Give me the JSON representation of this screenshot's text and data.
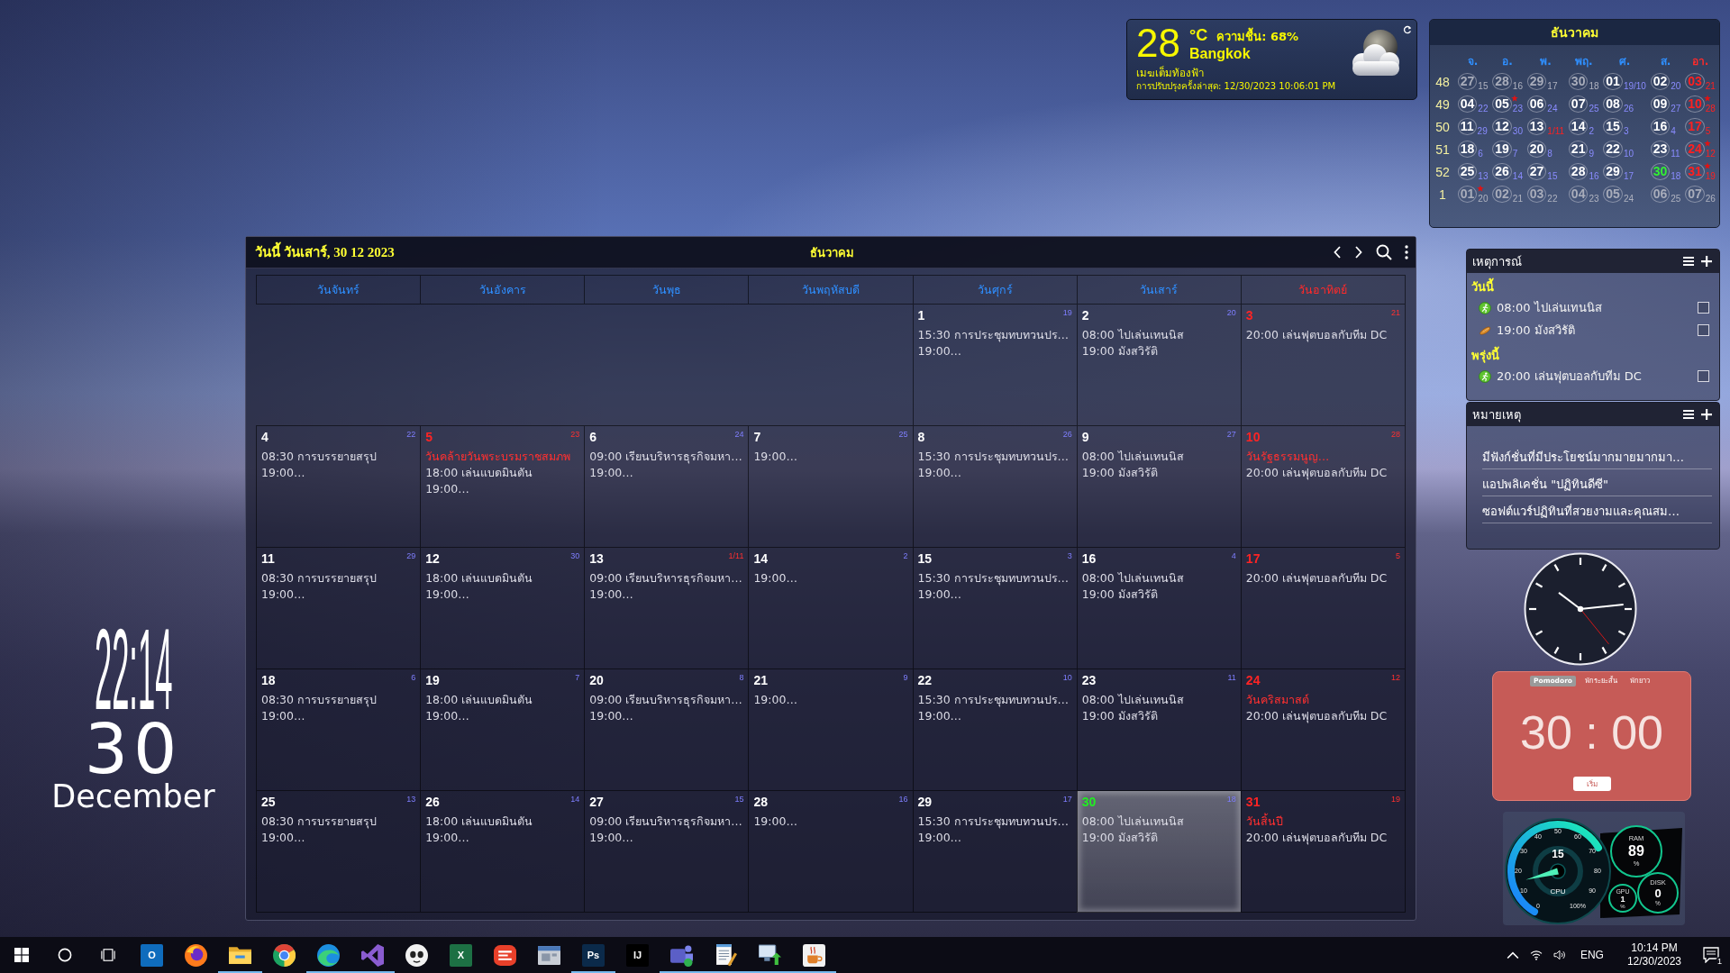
{
  "desktop_clock": {
    "time": "22:14",
    "day": "30",
    "month": "December"
  },
  "weather": {
    "temperature": "28",
    "unit": "°C",
    "humidity": "ความชื้น: 68%",
    "city": "Bangkok",
    "condition": "เมฆเต็มท้องฟ้า",
    "updated": "การปรับปรุงครั้งล่าสุด: 12/30/2023 10:06:01 PM"
  },
  "mini_calendar": {
    "title": "ธันวาคม",
    "weekdays": [
      {
        "label": "จ.",
        "kind": "weekday"
      },
      {
        "label": "อ.",
        "kind": "weekday"
      },
      {
        "label": "พ.",
        "kind": "weekday"
      },
      {
        "label": "พฤ.",
        "kind": "weekday"
      },
      {
        "label": "ศ.",
        "kind": "weekday"
      },
      {
        "label": "ส.",
        "kind": "weekday"
      },
      {
        "label": "อา.",
        "kind": "sunday"
      }
    ],
    "weeks": [
      {
        "number": "48",
        "days": [
          {
            "day": "27",
            "lunar": "15",
            "kind": "other",
            "star": false,
            "lunar_red": false
          },
          {
            "day": "28",
            "lunar": "16",
            "kind": "other",
            "star": false,
            "lunar_red": false
          },
          {
            "day": "29",
            "lunar": "17",
            "kind": "other",
            "star": false,
            "lunar_red": false
          },
          {
            "day": "30",
            "lunar": "18",
            "kind": "other",
            "star": false,
            "lunar_red": false
          },
          {
            "day": "01",
            "lunar": "19/10",
            "kind": "weekday",
            "star": false,
            "lunar_red": false
          },
          {
            "day": "02",
            "lunar": "20",
            "kind": "weekday",
            "star": false,
            "lunar_red": false
          },
          {
            "day": "03",
            "lunar": "21",
            "kind": "sunday",
            "star": false,
            "lunar_red": true
          }
        ]
      },
      {
        "number": "49",
        "days": [
          {
            "day": "04",
            "lunar": "22",
            "kind": "weekday",
            "star": false,
            "lunar_red": false
          },
          {
            "day": "05",
            "lunar": "23",
            "kind": "weekday",
            "star": true,
            "lunar_red": false
          },
          {
            "day": "06",
            "lunar": "24",
            "kind": "weekday",
            "star": false,
            "lunar_red": false
          },
          {
            "day": "07",
            "lunar": "25",
            "kind": "weekday",
            "star": false,
            "lunar_red": false
          },
          {
            "day": "08",
            "lunar": "26",
            "kind": "weekday",
            "star": false,
            "lunar_red": false
          },
          {
            "day": "09",
            "lunar": "27",
            "kind": "weekday",
            "star": false,
            "lunar_red": false
          },
          {
            "day": "10",
            "lunar": "28",
            "kind": "sunday",
            "star": true,
            "lunar_red": true
          }
        ]
      },
      {
        "number": "50",
        "days": [
          {
            "day": "11",
            "lunar": "29",
            "kind": "weekday",
            "star": false,
            "lunar_red": false
          },
          {
            "day": "12",
            "lunar": "30",
            "kind": "weekday",
            "star": false,
            "lunar_red": false
          },
          {
            "day": "13",
            "lunar": "1/11",
            "kind": "weekday",
            "star": false,
            "lunar_red": true
          },
          {
            "day": "14",
            "lunar": "2",
            "kind": "weekday",
            "star": false,
            "lunar_red": false
          },
          {
            "day": "15",
            "lunar": "3",
            "kind": "weekday",
            "star": false,
            "lunar_red": false
          },
          {
            "day": "16",
            "lunar": "4",
            "kind": "weekday",
            "star": false,
            "lunar_red": false
          },
          {
            "day": "17",
            "lunar": "5",
            "kind": "sunday",
            "star": false,
            "lunar_red": true
          }
        ]
      },
      {
        "number": "51",
        "days": [
          {
            "day": "18",
            "lunar": "6",
            "kind": "weekday",
            "star": false,
            "lunar_red": false
          },
          {
            "day": "19",
            "lunar": "7",
            "kind": "weekday",
            "star": false,
            "lunar_red": false
          },
          {
            "day": "20",
            "lunar": "8",
            "kind": "weekday",
            "star": false,
            "lunar_red": false
          },
          {
            "day": "21",
            "lunar": "9",
            "kind": "weekday",
            "star": false,
            "lunar_red": false
          },
          {
            "day": "22",
            "lunar": "10",
            "kind": "weekday",
            "star": false,
            "lunar_red": false
          },
          {
            "day": "23",
            "lunar": "11",
            "kind": "weekday",
            "star": false,
            "lunar_red": false
          },
          {
            "day": "24",
            "lunar": "12",
            "kind": "sunday",
            "star": true,
            "lunar_red": true
          }
        ]
      },
      {
        "number": "52",
        "days": [
          {
            "day": "25",
            "lunar": "13",
            "kind": "weekday",
            "star": false,
            "lunar_red": false
          },
          {
            "day": "26",
            "lunar": "14",
            "kind": "weekday",
            "star": false,
            "lunar_red": false
          },
          {
            "day": "27",
            "lunar": "15",
            "kind": "weekday",
            "star": false,
            "lunar_red": false
          },
          {
            "day": "28",
            "lunar": "16",
            "kind": "weekday",
            "star": false,
            "lunar_red": false
          },
          {
            "day": "29",
            "lunar": "17",
            "kind": "weekday",
            "star": false,
            "lunar_red": false
          },
          {
            "day": "30",
            "lunar": "18",
            "kind": "today",
            "star": false,
            "lunar_red": false
          },
          {
            "day": "31",
            "lunar": "19",
            "kind": "sunday",
            "star": true,
            "lunar_red": true
          }
        ]
      },
      {
        "number": "1",
        "days": [
          {
            "day": "01",
            "lunar": "20",
            "kind": "other",
            "star": true,
            "lunar_red": false
          },
          {
            "day": "02",
            "lunar": "21",
            "kind": "other",
            "star": false,
            "lunar_red": false
          },
          {
            "day": "03",
            "lunar": "22",
            "kind": "other",
            "star": false,
            "lunar_red": false
          },
          {
            "day": "04",
            "lunar": "23",
            "kind": "other",
            "star": false,
            "lunar_red": false
          },
          {
            "day": "05",
            "lunar": "24",
            "kind": "other",
            "star": false,
            "lunar_red": false
          },
          {
            "day": "06",
            "lunar": "25",
            "kind": "other",
            "star": false,
            "lunar_red": false
          },
          {
            "day": "07",
            "lunar": "26",
            "kind": "other",
            "star": false,
            "lunar_red": false
          }
        ]
      }
    ]
  },
  "calendar": {
    "today_label": "วันนี้ วันเสาร์, 30 12 2023",
    "month": "ธันวาคม",
    "weekdays": [
      {
        "label": "วันจันทร์",
        "kind": "weekday"
      },
      {
        "label": "วันอังคาร",
        "kind": "weekday"
      },
      {
        "label": "วันพุธ",
        "kind": "weekday"
      },
      {
        "label": "วันพฤหัสบดี",
        "kind": "weekday"
      },
      {
        "label": "วันศุกร์",
        "kind": "weekday"
      },
      {
        "label": "วันเสาร์",
        "kind": "weekday"
      },
      {
        "label": "วันอาทิตย์",
        "kind": "sunday"
      }
    ],
    "weeks": [
      {
        "cells": [
          {
            "kind": "blank"
          },
          {
            "kind": "blank"
          },
          {
            "kind": "blank"
          },
          {
            "kind": "blank"
          },
          {
            "day": "1",
            "lunar": "19",
            "kind": "weekday",
            "lunar_red": false,
            "events": [
              {
                "text": "15:30 การประชุมทบทวนปร…",
                "kind": "event"
              },
              {
                "text": "19:00…",
                "kind": "event"
              }
            ]
          },
          {
            "day": "2",
            "lunar": "20",
            "kind": "weekday",
            "lunar_red": false,
            "events": [
              {
                "text": "08:00 ไปเล่นเทนนิส",
                "kind": "event"
              },
              {
                "text": "19:00 มังสวิรัติ",
                "kind": "event"
              }
            ]
          },
          {
            "day": "3",
            "lunar": "21",
            "kind": "sunday",
            "lunar_red": true,
            "events": [
              {
                "text": "20:00 เล่นฟุตบอลกับทีม DC",
                "kind": "event"
              }
            ]
          }
        ]
      },
      {
        "cells": [
          {
            "day": "4",
            "lunar": "22",
            "kind": "weekday",
            "lunar_red": false,
            "events": [
              {
                "text": "08:30 การบรรยายสรุป",
                "kind": "event"
              },
              {
                "text": "19:00…",
                "kind": "event"
              }
            ]
          },
          {
            "day": "5",
            "lunar": "23",
            "kind": "holiday",
            "lunar_red": true,
            "events": [
              {
                "text": "วันคล้ายวันพระบรมราชสมภพ",
                "kind": "holiday"
              },
              {
                "text": "18:00 เล่นแบดมินตัน",
                "kind": "event"
              },
              {
                "text": "19:00…",
                "kind": "event"
              }
            ]
          },
          {
            "day": "6",
            "lunar": "24",
            "kind": "weekday",
            "lunar_red": false,
            "events": [
              {
                "text": "09:00 เรียนบริหารธุรกิจมหา…",
                "kind": "event"
              },
              {
                "text": "19:00…",
                "kind": "event"
              }
            ]
          },
          {
            "day": "7",
            "lunar": "25",
            "kind": "weekday",
            "lunar_red": false,
            "events": [
              {
                "text": "19:00…",
                "kind": "event"
              }
            ]
          },
          {
            "day": "8",
            "lunar": "26",
            "kind": "weekday",
            "lunar_red": false,
            "events": [
              {
                "text": "15:30 การประชุมทบทวนปร…",
                "kind": "event"
              },
              {
                "text": "19:00…",
                "kind": "event"
              }
            ]
          },
          {
            "day": "9",
            "lunar": "27",
            "kind": "weekday",
            "lunar_red": false,
            "events": [
              {
                "text": "08:00 ไปเล่นเทนนิส",
                "kind": "event"
              },
              {
                "text": "19:00 มังสวิรัติ",
                "kind": "event"
              }
            ]
          },
          {
            "day": "10",
            "lunar": "28",
            "kind": "sunday",
            "lunar_red": true,
            "events": [
              {
                "text": "วันรัฐธรรมนูญ…",
                "kind": "holiday"
              },
              {
                "text": "20:00 เล่นฟุตบอลกับทีม DC",
                "kind": "event"
              }
            ]
          }
        ]
      },
      {
        "cells": [
          {
            "day": "11",
            "lunar": "29",
            "kind": "weekday",
            "lunar_red": false,
            "events": [
              {
                "text": "08:30 การบรรยายสรุป",
                "kind": "event"
              },
              {
                "text": "19:00…",
                "kind": "event"
              }
            ]
          },
          {
            "day": "12",
            "lunar": "30",
            "kind": "weekday",
            "lunar_red": false,
            "events": [
              {
                "text": "18:00 เล่นแบดมินตัน",
                "kind": "event"
              },
              {
                "text": "19:00…",
                "kind": "event"
              }
            ]
          },
          {
            "day": "13",
            "lunar": "1/11",
            "kind": "weekday",
            "lunar_red": true,
            "events": [
              {
                "text": "09:00 เรียนบริหารธุรกิจมหา…",
                "kind": "event"
              },
              {
                "text": "19:00…",
                "kind": "event"
              }
            ]
          },
          {
            "day": "14",
            "lunar": "2",
            "kind": "weekday",
            "lunar_red": false,
            "events": [
              {
                "text": "19:00…",
                "kind": "event"
              }
            ]
          },
          {
            "day": "15",
            "lunar": "3",
            "kind": "weekday",
            "lunar_red": false,
            "events": [
              {
                "text": "15:30 การประชุมทบทวนปร…",
                "kind": "event"
              },
              {
                "text": "19:00…",
                "kind": "event"
              }
            ]
          },
          {
            "day": "16",
            "lunar": "4",
            "kind": "weekday",
            "lunar_red": false,
            "events": [
              {
                "text": "08:00 ไปเล่นเทนนิส",
                "kind": "event"
              },
              {
                "text": "19:00 มังสวิรัติ",
                "kind": "event"
              }
            ]
          },
          {
            "day": "17",
            "lunar": "5",
            "kind": "sunday",
            "lunar_red": true,
            "events": [
              {
                "text": "20:00 เล่นฟุตบอลกับทีม DC",
                "kind": "event"
              }
            ]
          }
        ]
      },
      {
        "cells": [
          {
            "day": "18",
            "lunar": "6",
            "kind": "weekday",
            "lunar_red": false,
            "events": [
              {
                "text": "08:30 การบรรยายสรุป",
                "kind": "event"
              },
              {
                "text": "19:00…",
                "kind": "event"
              }
            ]
          },
          {
            "day": "19",
            "lunar": "7",
            "kind": "weekday",
            "lunar_red": false,
            "events": [
              {
                "text": "18:00 เล่นแบดมินตัน",
                "kind": "event"
              },
              {
                "text": "19:00…",
                "kind": "event"
              }
            ]
          },
          {
            "day": "20",
            "lunar": "8",
            "kind": "weekday",
            "lunar_red": false,
            "events": [
              {
                "text": "09:00 เรียนบริหารธุรกิจมหา…",
                "kind": "event"
              },
              {
                "text": "19:00…",
                "kind": "event"
              }
            ]
          },
          {
            "day": "21",
            "lunar": "9",
            "kind": "weekday",
            "lunar_red": false,
            "events": [
              {
                "text": "19:00…",
                "kind": "event"
              }
            ]
          },
          {
            "day": "22",
            "lunar": "10",
            "kind": "weekday",
            "lunar_red": false,
            "events": [
              {
                "text": "15:30 การประชุมทบทวนปร…",
                "kind": "event"
              },
              {
                "text": "19:00…",
                "kind": "event"
              }
            ]
          },
          {
            "day": "23",
            "lunar": "11",
            "kind": "weekday",
            "lunar_red": false,
            "events": [
              {
                "text": "08:00 ไปเล่นเทนนิส",
                "kind": "event"
              },
              {
                "text": "19:00 มังสวิรัติ",
                "kind": "event"
              }
            ]
          },
          {
            "day": "24",
            "lunar": "12",
            "kind": "sunday",
            "lunar_red": true,
            "events": [
              {
                "text": "วันคริสมาสต์",
                "kind": "holiday"
              },
              {
                "text": "20:00 เล่นฟุตบอลกับทีม DC",
                "kind": "event"
              }
            ]
          }
        ]
      },
      {
        "cells": [
          {
            "day": "25",
            "lunar": "13",
            "kind": "weekday",
            "lunar_red": false,
            "events": [
              {
                "text": "08:30 การบรรยายสรุป",
                "kind": "event"
              },
              {
                "text": "19:00…",
                "kind": "event"
              }
            ]
          },
          {
            "day": "26",
            "lunar": "14",
            "kind": "weekday",
            "lunar_red": false,
            "events": [
              {
                "text": "18:00 เล่นแบดมินตัน",
                "kind": "event"
              },
              {
                "text": "19:00…",
                "kind": "event"
              }
            ]
          },
          {
            "day": "27",
            "lunar": "15",
            "kind": "weekday",
            "lunar_red": false,
            "events": [
              {
                "text": "09:00 เรียนบริหารธุรกิจมหา…",
                "kind": "event"
              },
              {
                "text": "19:00…",
                "kind": "event"
              }
            ]
          },
          {
            "day": "28",
            "lunar": "16",
            "kind": "weekday",
            "lunar_red": false,
            "events": [
              {
                "text": "19:00…",
                "kind": "event"
              }
            ]
          },
          {
            "day": "29",
            "lunar": "17",
            "kind": "weekday",
            "lunar_red": false,
            "events": [
              {
                "text": "15:30 การประชุมทบทวนปร…",
                "kind": "event"
              },
              {
                "text": "19:00…",
                "kind": "event"
              }
            ]
          },
          {
            "day": "30",
            "lunar": "18",
            "kind": "today",
            "lunar_red": false,
            "events": [
              {
                "text": "08:00 ไปเล่นเทนนิส",
                "kind": "event"
              },
              {
                "text": "19:00 มังสวิรัติ",
                "kind": "event"
              }
            ]
          },
          {
            "day": "31",
            "lunar": "19",
            "kind": "sunday",
            "lunar_red": true,
            "events": [
              {
                "text": "วันสิ้นปี",
                "kind": "holiday"
              },
              {
                "text": "20:00 เล่นฟุตบอลกับทีม DC",
                "kind": "event"
              }
            ]
          }
        ]
      }
    ]
  },
  "events_panel": {
    "title": "เหตุการณ์",
    "groups": [
      {
        "label": "วันนี้",
        "items": [
          {
            "text": "08:00 ไปเล่นเทนนิส",
            "kind": "sport",
            "checked": false
          },
          {
            "text": "19:00 มังสวิรัติ",
            "kind": "food",
            "checked": false
          }
        ]
      },
      {
        "label": "พรุ่งนี้",
        "items": [
          {
            "text": "20:00 เล่นฟุตบอลกับทีม DC",
            "kind": "sport",
            "checked": false
          }
        ]
      }
    ]
  },
  "notes_panel": {
    "title": "หมายเหตุ",
    "notes": [
      "มีฟังก์ชั่นที่มีประโยชน์มากมายมากมา…",
      "แอปพลิเคชั่น \"ปฏิทินดีซี\"",
      "ซอฟต์แวร์ปฏิทินที่สวยงามและคุณสม…"
    ]
  },
  "pomodoro": {
    "tabs": [
      {
        "label": "Pomodoro",
        "selected": true
      },
      {
        "label": "พักระยะสั้น",
        "selected": false
      },
      {
        "label": "พักยาว",
        "selected": false
      }
    ],
    "time": "30 : 00",
    "button": "เริ่ม"
  },
  "system_monitor": {
    "cpu": {
      "label": "CPU",
      "value": "15",
      "level": 0.15,
      "ticks": [
        "0",
        "10",
        "20",
        "30",
        "40",
        "50",
        "60",
        "70",
        "80",
        "90",
        "100%"
      ]
    },
    "meters": [
      {
        "label": "RAM",
        "value": "89",
        "unit": "%"
      },
      {
        "label": "GPU",
        "value": "1",
        "unit": "%"
      },
      {
        "label": "DISK",
        "value": "0",
        "unit": "%"
      }
    ]
  },
  "taskbar": {
    "apps": [
      {
        "kind": "tile",
        "glyph": "O",
        "color": "#0f6cbd",
        "running": false
      },
      {
        "kind": "globe",
        "running": false
      },
      {
        "kind": "folder",
        "running": true
      },
      {
        "kind": "chrome",
        "running": false
      },
      {
        "kind": "swirl",
        "running": true
      },
      {
        "kind": "ribbon",
        "running": true
      },
      {
        "kind": "mascot",
        "running": false
      },
      {
        "kind": "tile",
        "glyph": "X",
        "color": "#1d7044",
        "running": false
      },
      {
        "kind": "badge",
        "running": false
      },
      {
        "kind": "window",
        "running": false
      },
      {
        "kind": "tile",
        "glyph": "Ps",
        "color": "#0b2a4a",
        "running": true
      },
      {
        "kind": "tile",
        "glyph": "IJ",
        "color": "#000000",
        "running": false
      },
      {
        "kind": "people",
        "running": true
      },
      {
        "kind": "notepad",
        "running": true
      },
      {
        "kind": "network",
        "running": true
      },
      {
        "kind": "cup",
        "running": true
      }
    ],
    "language": "ENG",
    "time": "10:14 PM",
    "date": "12/30/2023",
    "notifications": "1"
  }
}
